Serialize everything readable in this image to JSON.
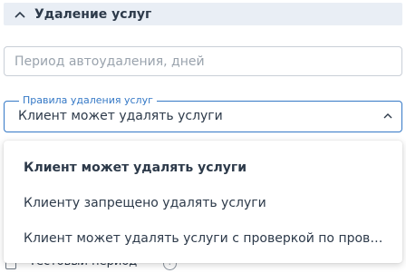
{
  "section": {
    "title": "Удаление услуг",
    "icon": "chevron-up-icon"
  },
  "period_input": {
    "value": "",
    "placeholder": "Период автоудаления, дней"
  },
  "rules_select": {
    "label": "Правила удаления услуг",
    "value": "Клиент может удалять услуги",
    "caret_icon": "chevron-up-icon"
  },
  "dropdown": {
    "options": [
      {
        "label": "Клиент может удалять услуги",
        "selected": true
      },
      {
        "label": "Клиенту запрещено удалять услуги",
        "selected": false
      },
      {
        "label": "Клиент может удалять услуги с проверкой по прове…",
        "selected": false
      }
    ]
  },
  "underlying": {
    "checkbox_label": "Тестовый период",
    "help_icon": "question-icon"
  },
  "colors": {
    "accent": "#3478c6",
    "header_bg": "#e9eef5",
    "text": "#2d3a4a",
    "placeholder": "#9aa3ad",
    "border": "#c9cfd7"
  }
}
